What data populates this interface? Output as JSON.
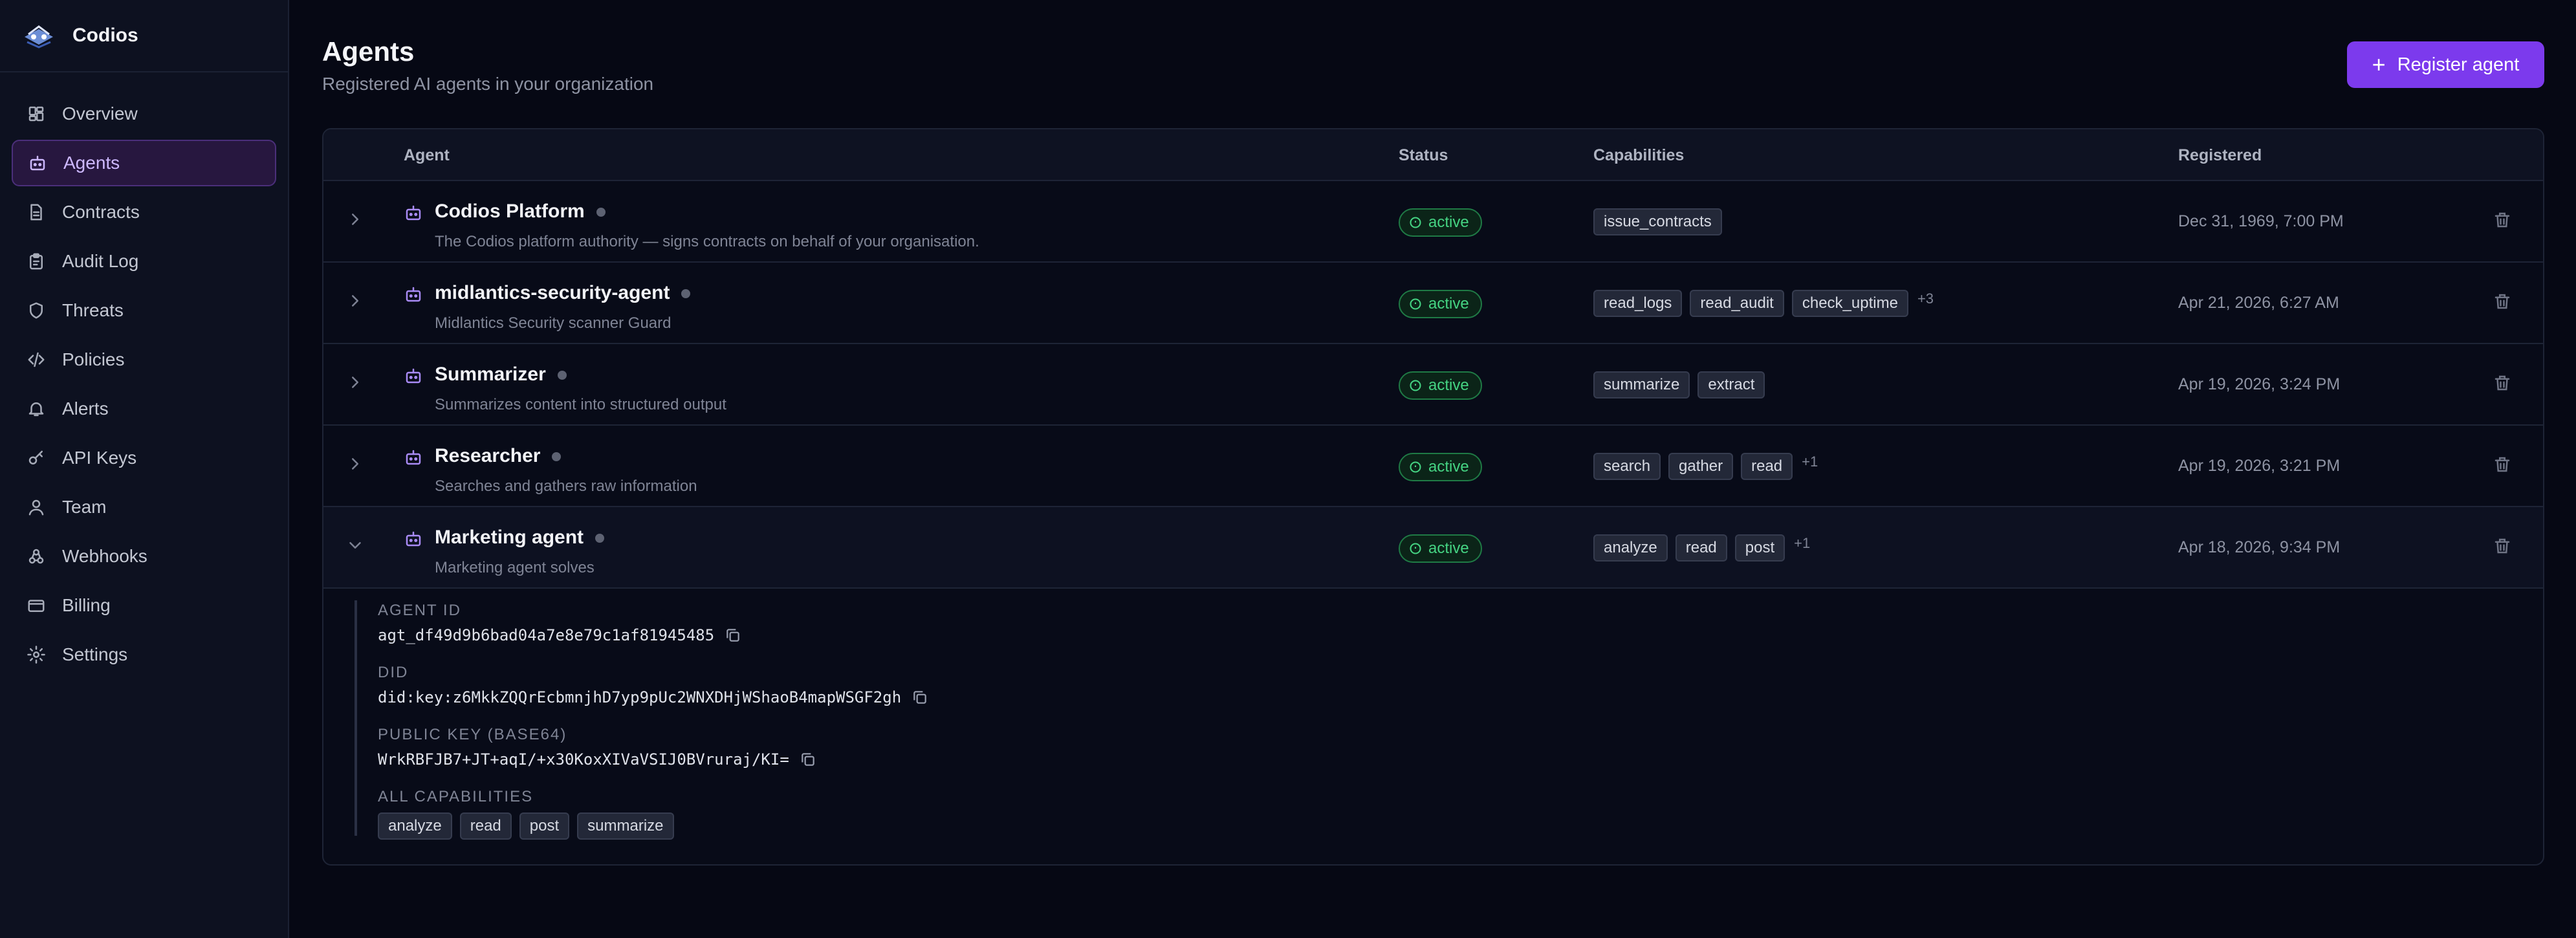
{
  "app": {
    "name": "Codios"
  },
  "sidebar": {
    "items": [
      {
        "label": "Overview",
        "icon": "grid-icon",
        "active": false
      },
      {
        "label": "Agents",
        "icon": "robot-icon",
        "active": true
      },
      {
        "label": "Contracts",
        "icon": "document-icon",
        "active": false
      },
      {
        "label": "Audit Log",
        "icon": "clipboard-icon",
        "active": false
      },
      {
        "label": "Threats",
        "icon": "shield-icon",
        "active": false
      },
      {
        "label": "Policies",
        "icon": "code-icon",
        "active": false
      },
      {
        "label": "Alerts",
        "icon": "bell-icon",
        "active": false
      },
      {
        "label": "API Keys",
        "icon": "key-icon",
        "active": false
      },
      {
        "label": "Team",
        "icon": "user-icon",
        "active": false
      },
      {
        "label": "Webhooks",
        "icon": "webhook-icon",
        "active": false
      },
      {
        "label": "Billing",
        "icon": "credit-card-icon",
        "active": false
      },
      {
        "label": "Settings",
        "icon": "gear-icon",
        "active": false
      }
    ]
  },
  "header": {
    "title": "Agents",
    "subtitle": "Registered AI agents in your organization",
    "register_label": "Register agent"
  },
  "table": {
    "columns": {
      "agent": "Agent",
      "status": "Status",
      "capabilities": "Capabilities",
      "registered": "Registered"
    },
    "rows": [
      {
        "name": "Codios Platform",
        "description": "The Codios platform authority — signs contracts on behalf of your organisation.",
        "status": "active",
        "capabilities": [
          "issue_contracts"
        ],
        "more": "",
        "registered": "Dec 31, 1969, 7:00 PM",
        "expanded": false
      },
      {
        "name": "midlantics-security-agent",
        "description": "Midlantics Security scanner Guard",
        "status": "active",
        "capabilities": [
          "read_logs",
          "read_audit",
          "check_uptime"
        ],
        "more": "+3",
        "registered": "Apr 21, 2026, 6:27 AM",
        "expanded": false
      },
      {
        "name": "Summarizer",
        "description": "Summarizes content into structured output",
        "status": "active",
        "capabilities": [
          "summarize",
          "extract"
        ],
        "more": "",
        "registered": "Apr 19, 2026, 3:24 PM",
        "expanded": false
      },
      {
        "name": "Researcher",
        "description": "Searches and gathers raw information",
        "status": "active",
        "capabilities": [
          "search",
          "gather",
          "read"
        ],
        "more": "+1",
        "registered": "Apr 19, 2026, 3:21 PM",
        "expanded": false
      },
      {
        "name": "Marketing agent",
        "description": "Marketing agent solves",
        "status": "active",
        "capabilities": [
          "analyze",
          "read",
          "post"
        ],
        "more": "+1",
        "registered": "Apr 18, 2026, 9:34 PM",
        "expanded": true
      }
    ]
  },
  "detail": {
    "agent_id_label": "AGENT ID",
    "agent_id": "agt_df49d9b6bad04a7e8e79c1af81945485",
    "did_label": "DID",
    "did": "did:key:z6MkkZQQrEcbmnjhD7yp9pUc2WNXDHjWShaoB4mapWSGF2gh",
    "public_key_label": "PUBLIC KEY (BASE64)",
    "public_key": "WrkRBFJB7+JT+aqI/+x30KoxXIVaVSIJ0BVruraj/KI=",
    "all_capabilities_label": "ALL CAPABILITIES",
    "all_capabilities": [
      "analyze",
      "read",
      "post",
      "summarize"
    ]
  },
  "colors": {
    "accent": "#7c3aed",
    "status_active": "#45d483",
    "background": "#060814"
  }
}
